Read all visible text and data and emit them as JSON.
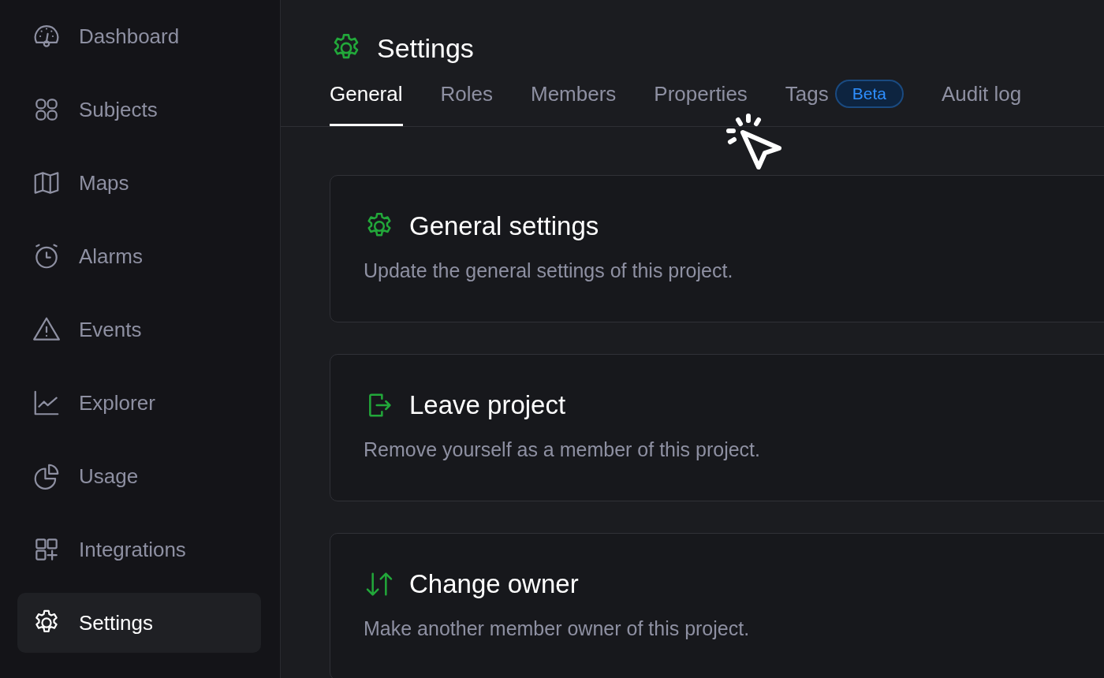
{
  "sidebar": {
    "items": [
      {
        "label": "Dashboard",
        "selected": false
      },
      {
        "label": "Subjects",
        "selected": false
      },
      {
        "label": "Maps",
        "selected": false
      },
      {
        "label": "Alarms",
        "selected": false
      },
      {
        "label": "Events",
        "selected": false
      },
      {
        "label": "Explorer",
        "selected": false
      },
      {
        "label": "Usage",
        "selected": false
      },
      {
        "label": "Integrations",
        "selected": false
      },
      {
        "label": "Settings",
        "selected": true
      }
    ]
  },
  "page": {
    "title": "Settings"
  },
  "tabs": [
    {
      "label": "General",
      "selected": true
    },
    {
      "label": "Roles",
      "selected": false
    },
    {
      "label": "Members",
      "selected": false
    },
    {
      "label": "Properties",
      "selected": false
    },
    {
      "label": "Tags",
      "selected": false,
      "badge": "Beta"
    },
    {
      "label": "Audit log",
      "selected": false
    }
  ],
  "cards": [
    {
      "title": "General settings",
      "description": "Update the general settings of this project."
    },
    {
      "title": "Leave project",
      "description": "Remove yourself as a member of this project."
    },
    {
      "title": "Change owner",
      "description": "Make another member owner of this project."
    }
  ]
}
